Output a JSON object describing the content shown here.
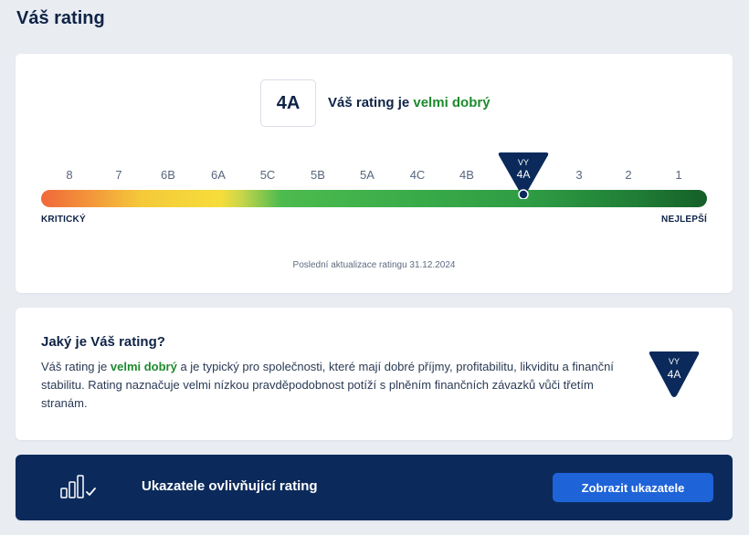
{
  "page": {
    "title": "Váš rating"
  },
  "rating": {
    "value": "4A",
    "text_prefix": "Váš rating je ",
    "text_grade": "velmi dobrý",
    "scale": [
      "8",
      "7",
      "6B",
      "6A",
      "5C",
      "5B",
      "5A",
      "4C",
      "4B",
      "4A",
      "3",
      "2",
      "1"
    ],
    "marker_prefix": "VY",
    "marker_value": "4A",
    "low_label": "KRITICKÝ",
    "high_label": "NEJLEPŠÍ",
    "update_note": "Poslední aktualizace ratingu 31.12.2024"
  },
  "info": {
    "title": "Jaký je Váš rating?",
    "body_prefix": "Váš rating je ",
    "body_grade": "velmi dobrý",
    "body_rest": " a je typický pro společnosti, které mají dobré příjmy, profitabilitu, likviditu a finanční stabilitu. Rating naznačuje velmi nízkou pravděpodobnost potíží s plněním finančních závazků vůči třetím stranám.",
    "badge_prefix": "VY",
    "badge_value": "4A"
  },
  "indicators": {
    "icon": "bar-chart-check-icon",
    "title": "Ukazatele ovlivňující rating",
    "button_label": "Zobrazit ukazatele"
  },
  "colors": {
    "navy": "#0b2a5b",
    "grade_green": "#1e8a2e",
    "button_blue": "#1e63d8"
  }
}
